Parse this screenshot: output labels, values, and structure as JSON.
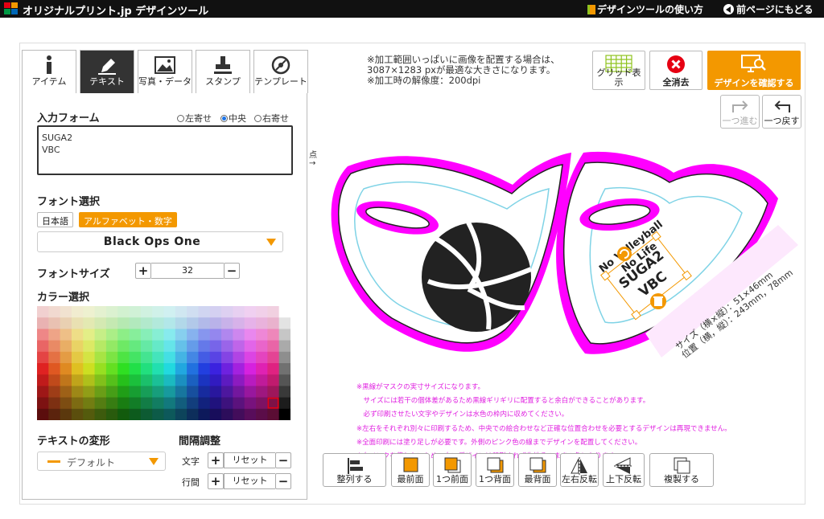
{
  "header": {
    "brand": "オリジナルプリント.jp デザインツール",
    "how_to": "デザインツールの使い方",
    "back": "前ページにもどる"
  },
  "tabs": [
    {
      "label": "アイテム"
    },
    {
      "label": "テキスト"
    },
    {
      "label": "写真・データ"
    },
    {
      "label": "スタンプ"
    },
    {
      "label": "テンプレート"
    }
  ],
  "text_panel": {
    "input_form_label": "入力フォーム",
    "align_left": "左寄せ",
    "align_center": "中央",
    "align_right": "右寄せ",
    "text_line1": "SUGA2",
    "text_line2": "VBC",
    "font_select_label": "フォント選択",
    "font_jp": "日本語",
    "font_alpha": "アルファベット・数字",
    "font_name": "Black Ops One",
    "font_size_label": "フォントサイズ",
    "font_size_value": "32",
    "plus": "+",
    "minus": "−",
    "color_select_label": "カラー選択",
    "transform_label": "テキストの変形",
    "transform_value": "デフォルト",
    "spacing_label": "間隔調整",
    "char_label": "文字",
    "line_label": "行間",
    "reset": "リセット"
  },
  "notice": {
    "line1": "※加工範囲いっぱいに画像を配置する場合は、",
    "line2": "3087×1283 pxが最適な大きさになります。",
    "line3": "※加工時の解像度：200dpi"
  },
  "tools": {
    "grid": "グリッド表示",
    "clear": "全消去",
    "confirm": "デザインを確認する",
    "redo": "一つ進む",
    "undo": "一つ戻す",
    "side_mark": "点→"
  },
  "canvas": {
    "text_no_volleyball": "No Volleyball",
    "text_no_life": "No Life",
    "text_suga2": "SUGA2",
    "text_vbc": "VBC",
    "size_label": "サイズ（横×縦）：51×46mm",
    "pos_label": "位置（横，縦）：243mm，78mm"
  },
  "notes": [
    "※黒線がマスクの実寸サイズになります。",
    "　サイズには若干の個体差があるため黒線ギリギリに配置すると余白ができることがあります。",
    "　必ず印刷させたい文字やデザインは水色の枠内に収めてください。",
    "※左右をそれぞれ別々に印刷するため、中央での絵合わせなど正確な位置合わせを必要とするデザインは再現できません。",
    "※全面印刷には塗り足しが必要です。外側のピンク色の線までデザインを配置してください。",
    "※白インクを使わないため、白いデザインは印刷されず生地そのままの色になります。"
  ],
  "bottom_tools": {
    "align": "整列する",
    "front": "最前面",
    "forward": "1つ前面",
    "backward": "1つ背面",
    "back": "最背面",
    "flip_h": "左右反転",
    "flip_v": "上下反転",
    "duplicate": "複製する"
  },
  "colors": {
    "accent_orange": "#f39800",
    "clear_red": "#e60012",
    "mask_magenta": "#ff00ff",
    "guide_cyan": "#7fd3e6",
    "note_pink": "#e020e0"
  }
}
